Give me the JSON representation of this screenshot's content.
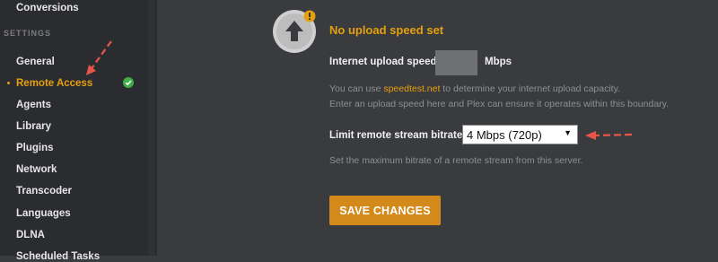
{
  "sidebar": {
    "items_top": [
      {
        "label": "Conversions"
      }
    ],
    "section_label": "SETTINGS",
    "items": [
      {
        "label": "General"
      },
      {
        "label": "Remote Access"
      },
      {
        "label": "Agents"
      },
      {
        "label": "Library"
      },
      {
        "label": "Plugins"
      },
      {
        "label": "Network"
      },
      {
        "label": "Transcoder"
      },
      {
        "label": "Languages"
      },
      {
        "label": "DLNA"
      },
      {
        "label": "Scheduled Tasks"
      }
    ]
  },
  "main": {
    "heading": "No upload speed set",
    "upload_speed": {
      "label": "Internet upload speed",
      "value": "",
      "unit": "Mbps"
    },
    "help_line1_prefix": "You can use ",
    "help_line1_link": "speedtest.net",
    "help_line1_suffix": " to determine your internet upload capacity.",
    "help_line2": "Enter an upload speed here and Plex can ensure it operates within this boundary.",
    "bitrate": {
      "label": "Limit remote stream bitrate",
      "selected": "4 Mbps (720p)"
    },
    "bitrate_help": "Set the maximum bitrate of a remote stream from this server.",
    "save_label": "SAVE CHANGES"
  },
  "colors": {
    "accent": "#e5a00d",
    "annotation_arrow": "#e8564a",
    "status_ok": "#3fae49"
  },
  "icons": [
    "upload-arrow-icon",
    "warning-icon",
    "check-circle-icon",
    "chevron-down-icon"
  ]
}
